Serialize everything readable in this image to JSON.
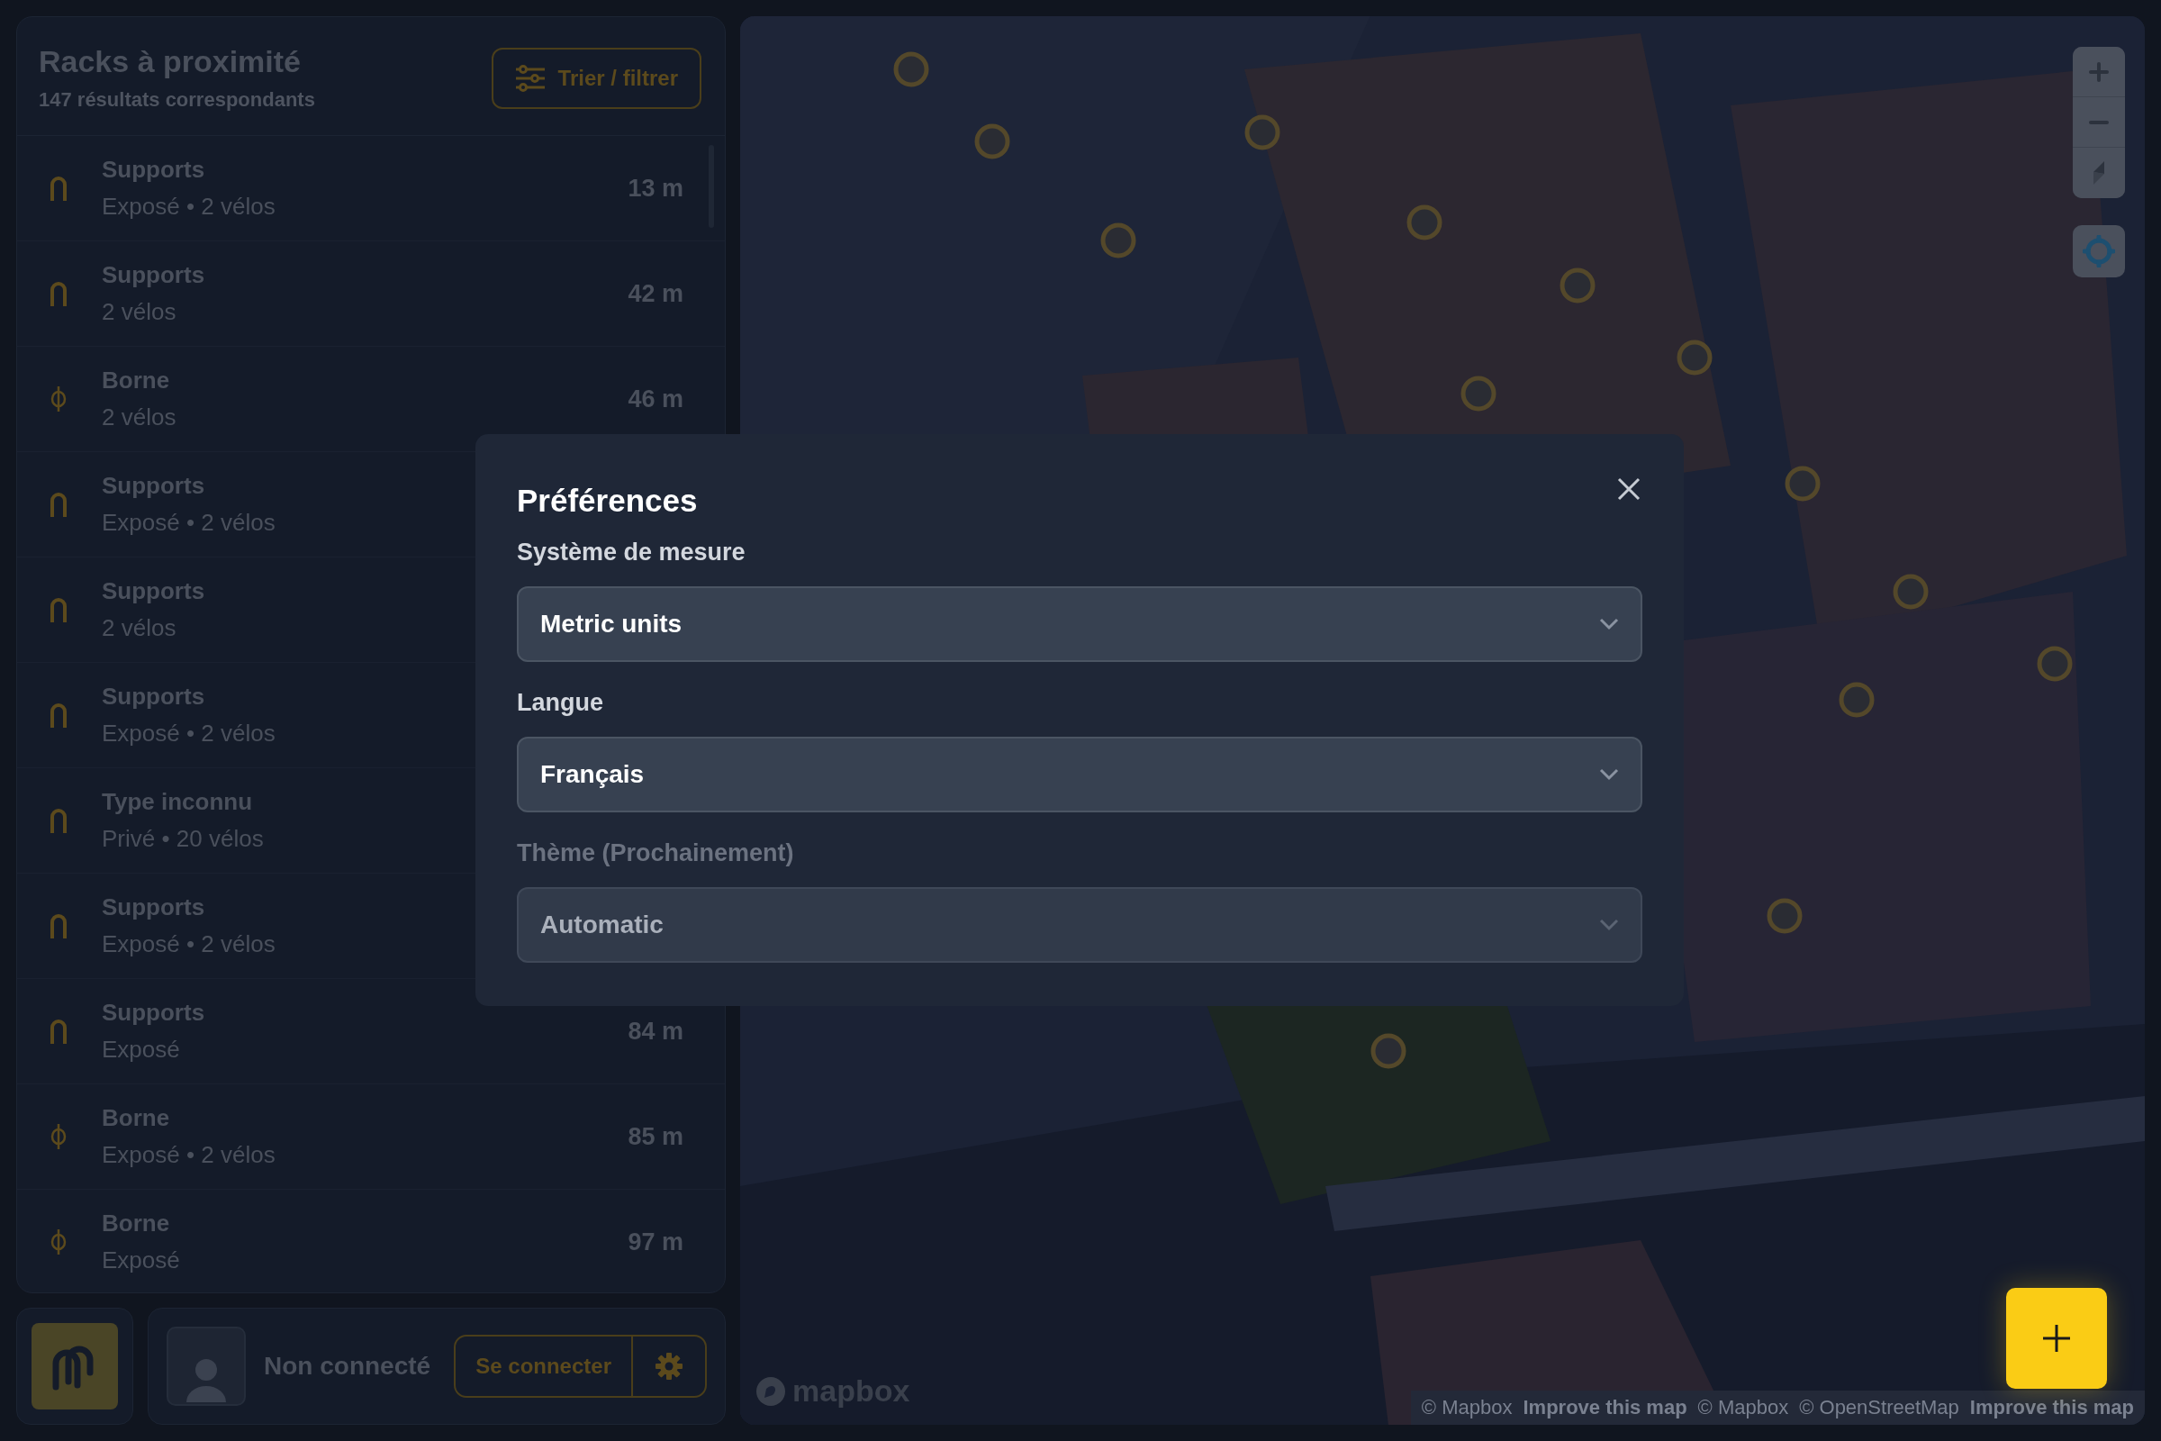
{
  "sidebar": {
    "title": "Racks à proximité",
    "subtitle": "147 résultats correspondants",
    "filter_button": "Trier / filtrer",
    "racks": [
      {
        "kind": "rack",
        "type": "Supports",
        "details": "Exposé • 2 vélos",
        "distance": "13 m"
      },
      {
        "kind": "rack",
        "type": "Supports",
        "details": "2 vélos",
        "distance": "42 m"
      },
      {
        "kind": "post",
        "type": "Borne",
        "details": "2 vélos",
        "distance": "46 m"
      },
      {
        "kind": "rack",
        "type": "Supports",
        "details": "Exposé • 2 vélos"
      },
      {
        "kind": "rack",
        "type": "Supports",
        "details": "2 vélos"
      },
      {
        "kind": "rack",
        "type": "Supports",
        "details": "Exposé • 2 vélos"
      },
      {
        "kind": "rack",
        "type": "Type inconnu",
        "details": "Privé • 20 vélos"
      },
      {
        "kind": "rack",
        "type": "Supports",
        "details": "Exposé • 2 vélos"
      },
      {
        "kind": "rack",
        "type": "Supports",
        "details": "Exposé",
        "distance": "84 m"
      },
      {
        "kind": "post",
        "type": "Borne",
        "details": "Exposé • 2 vélos",
        "distance": "85 m"
      },
      {
        "kind": "post",
        "type": "Borne",
        "details": "Exposé",
        "distance": "97 m"
      }
    ]
  },
  "bottom_bar": {
    "status": "Non connecté",
    "login_button": "Se connecter"
  },
  "map": {
    "kind": "picture",
    "logo": "mapbox",
    "attribution": [
      {
        "kind": "text",
        "text": "© Mapbox"
      },
      {
        "kind": "link",
        "text": "Improve this map"
      },
      {
        "kind": "text",
        "text": "© Mapbox"
      },
      {
        "kind": "text",
        "text": "© OpenStreetMap"
      },
      {
        "kind": "link",
        "text": "Improve this map"
      }
    ]
  },
  "preferences": {
    "title": "Préférences",
    "fields": [
      {
        "label": "Système de mesure",
        "value": "Metric units",
        "disabled": false
      },
      {
        "label": "Langue",
        "value": "Français",
        "disabled": false
      },
      {
        "label": "Thème (Prochainement)",
        "value": "Automatic",
        "disabled": true
      }
    ]
  }
}
